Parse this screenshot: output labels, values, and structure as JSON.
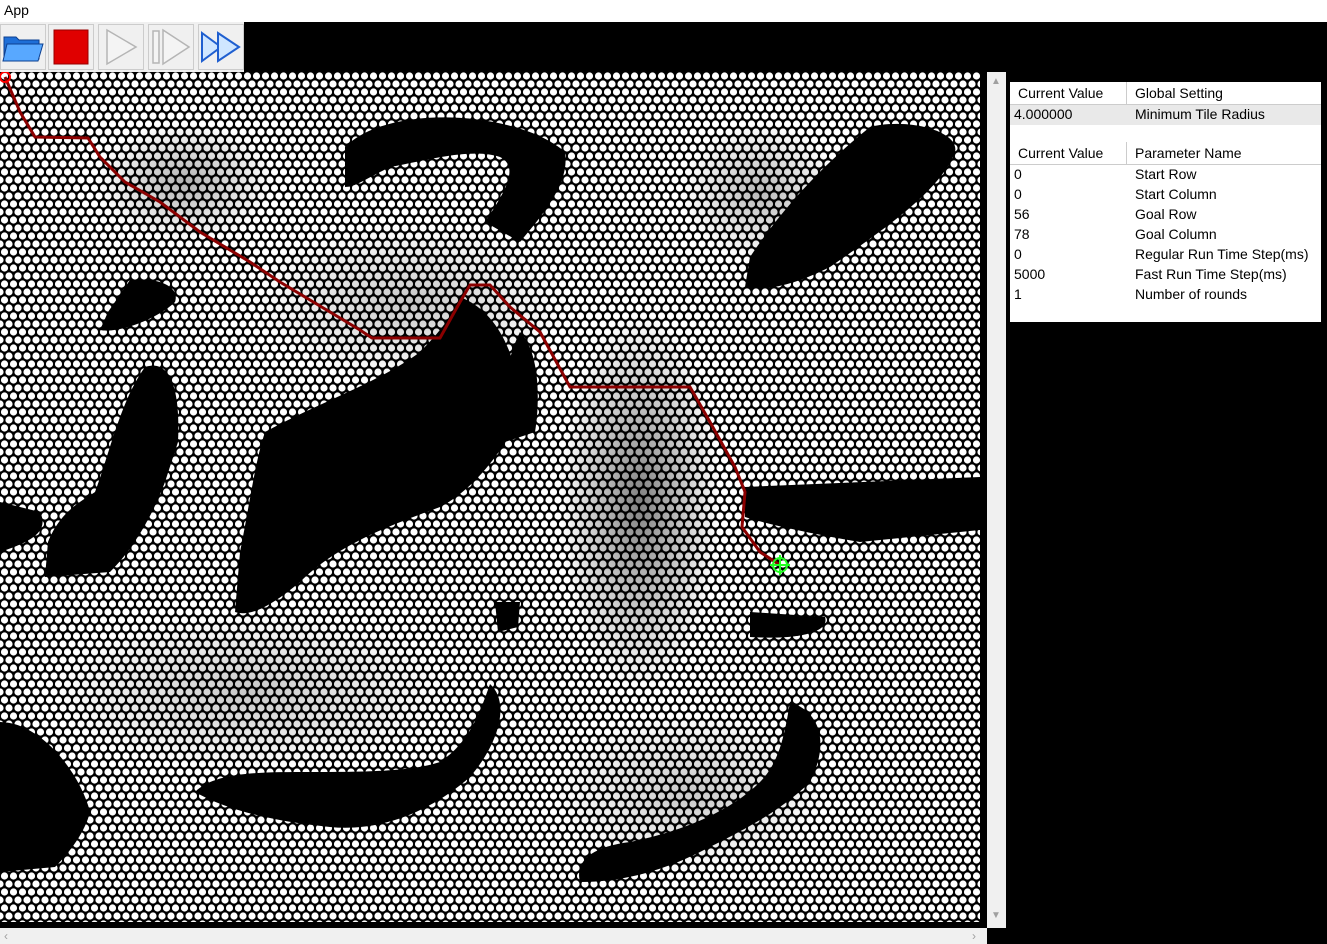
{
  "window": {
    "title": "App"
  },
  "toolbar": {
    "buttons": [
      {
        "name": "open-folder-button",
        "icon": "folder-icon"
      },
      {
        "name": "stop-button",
        "icon": "stop-icon"
      },
      {
        "name": "run-button",
        "icon": "play-icon"
      },
      {
        "name": "step-button",
        "icon": "step-icon"
      },
      {
        "name": "fast-run-button",
        "icon": "fast-forward-icon"
      }
    ]
  },
  "global_settings": {
    "headers": {
      "value": "Current Value",
      "name": "Global Setting"
    },
    "rows": [
      {
        "value": "4.000000",
        "name": "Minimum Tile Radius"
      }
    ]
  },
  "parameters": {
    "headers": {
      "value": "Current Value",
      "name": "Parameter Name"
    },
    "rows": [
      {
        "value": "0",
        "name": "Start Row"
      },
      {
        "value": "0",
        "name": "Start Column"
      },
      {
        "value": "56",
        "name": "Goal Row"
      },
      {
        "value": "78",
        "name": "Goal Column"
      },
      {
        "value": "0",
        "name": "Regular Run Time Step(ms)"
      },
      {
        "value": "5000",
        "name": "Fast Run Time Step(ms)"
      },
      {
        "value": "1",
        "name": "Number of rounds"
      }
    ]
  },
  "colors": {
    "path": "#8b0000",
    "start_marker": "#ff0000",
    "goal_marker": "#22ff22",
    "obstacle": "#000000",
    "tile": "#ffffff"
  }
}
